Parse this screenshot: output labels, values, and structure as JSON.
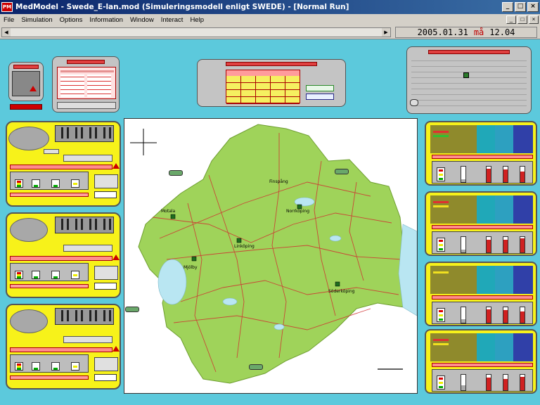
{
  "window": {
    "title": "MedModel - Swede_E-lan.mod (Simuleringsmodell enligt SWEDE) - [Normal Run]",
    "app_icon_text": "PM"
  },
  "menu": [
    "File",
    "Simulation",
    "Options",
    "Information",
    "Window",
    "Interact",
    "Help"
  ],
  "clock": {
    "date": "2005.01.31",
    "day": "må",
    "time": "12.04"
  },
  "map": {
    "cities": [
      "Finspång",
      "Motala",
      "Linköping",
      "Norrköping",
      "Mjölby",
      "Söderköping"
    ]
  },
  "colors": {
    "background": "#5cc9dc",
    "panel_yellow": "#f7f21a",
    "map_land": "#9fd35a",
    "title_blue": "#0a246a"
  }
}
